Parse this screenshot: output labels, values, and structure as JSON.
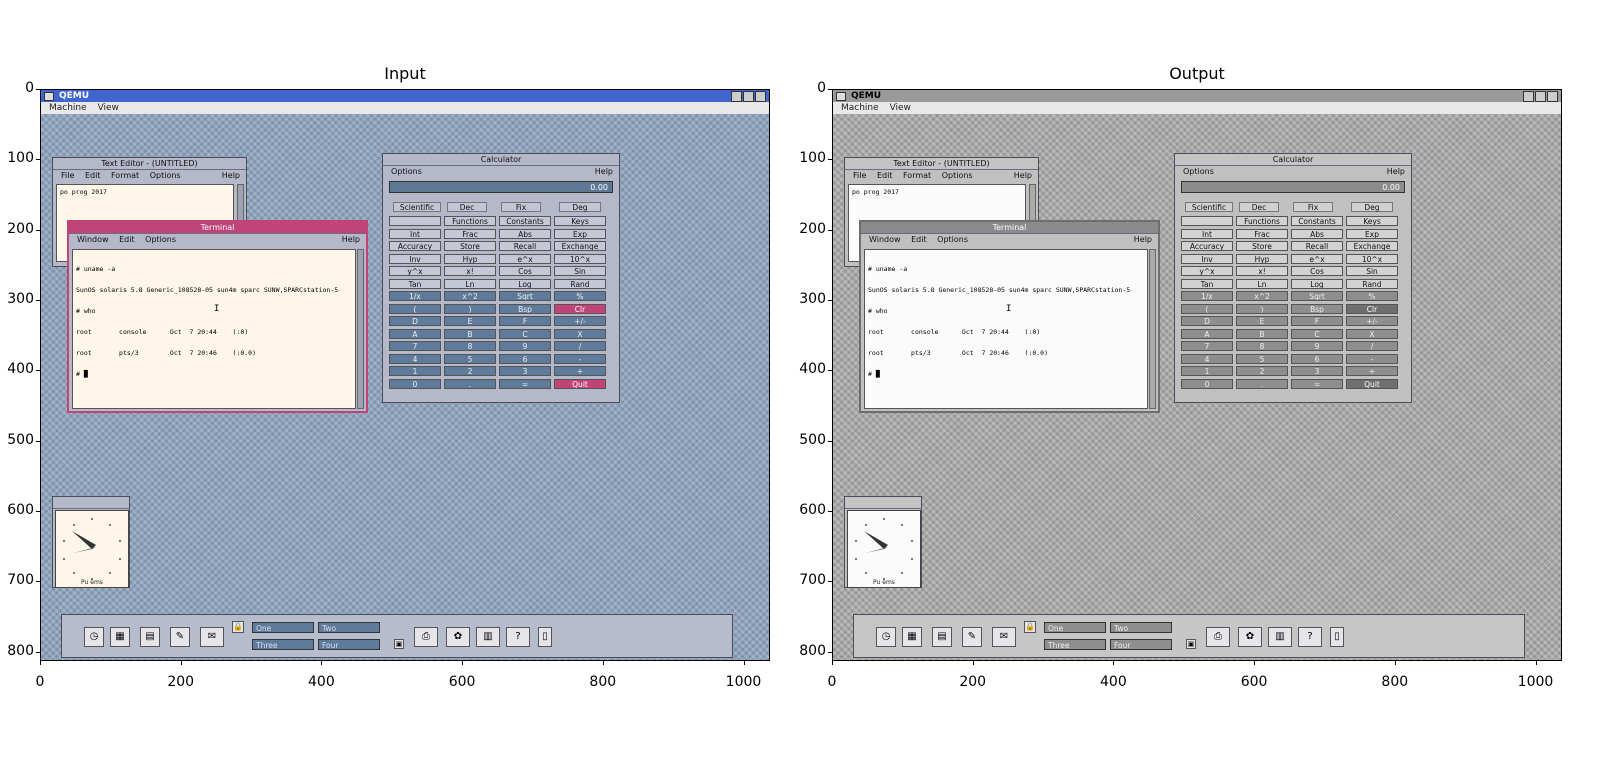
{
  "panels": [
    {
      "title": "Input",
      "theme": "blue"
    },
    {
      "title": "Output",
      "theme": "gray"
    }
  ],
  "axes": {
    "y_ticks": [
      "0",
      "100",
      "200",
      "300",
      "400",
      "500",
      "600",
      "700",
      "800"
    ],
    "x_ticks": [
      "0",
      "200",
      "400",
      "600",
      "800",
      "1000"
    ]
  },
  "qemu": {
    "title": "QEMU",
    "menu": [
      "Machine",
      "View"
    ]
  },
  "text_editor": {
    "title": "Text Editor - (UNTITLED)",
    "menu": [
      "File",
      "Edit",
      "Format",
      "Options"
    ],
    "help": "Help",
    "content": "po prog 2017"
  },
  "terminal": {
    "title": "Terminal",
    "menu": [
      "Window",
      "Edit",
      "Options"
    ],
    "help": "Help",
    "lines": [
      "# uname -a",
      "SunOS solaris 5.8 Generic_108528-05 sun4m sparc SUNW,SPARCstation-5",
      "# who",
      "root       console      Oct  7 20:44    (:0)",
      "root       pts/3        Oct  7 20:46    (:0.0)",
      "# █"
    ]
  },
  "calculator": {
    "title": "Calculator",
    "menu_options": "Options",
    "help": "Help",
    "display": "0.00",
    "mode": "Scientific",
    "base": "Dec",
    "notation": "Fix",
    "trig": "Deg",
    "keys": [
      "",
      "Functions",
      "Constants",
      "Keys",
      "Int",
      "Frac",
      "Abs",
      "Exp",
      "Accuracy",
      "Store",
      "Recall",
      "Exchange",
      "Inv",
      "Hyp",
      "e^x",
      "10^x",
      "y^x",
      "x!",
      "Cos",
      "Sin",
      "Tan",
      "Ln",
      "Log",
      "Rand",
      "1/x",
      "x^2",
      "Sqrt",
      "%",
      "(",
      ")",
      "Bsp",
      "Clr",
      "D",
      "E",
      "F",
      "+/-",
      "A",
      "B",
      "C",
      "X",
      "7",
      "8",
      "9",
      "/",
      "4",
      "5",
      "6",
      "-",
      "1",
      "2",
      "3",
      "+",
      "0",
      ".",
      "=",
      "Quit"
    ]
  },
  "clock": {
    "label": "Pu ems"
  },
  "front_panel": {
    "workspaces": [
      "One",
      "Two",
      "Three",
      "Four"
    ]
  }
}
